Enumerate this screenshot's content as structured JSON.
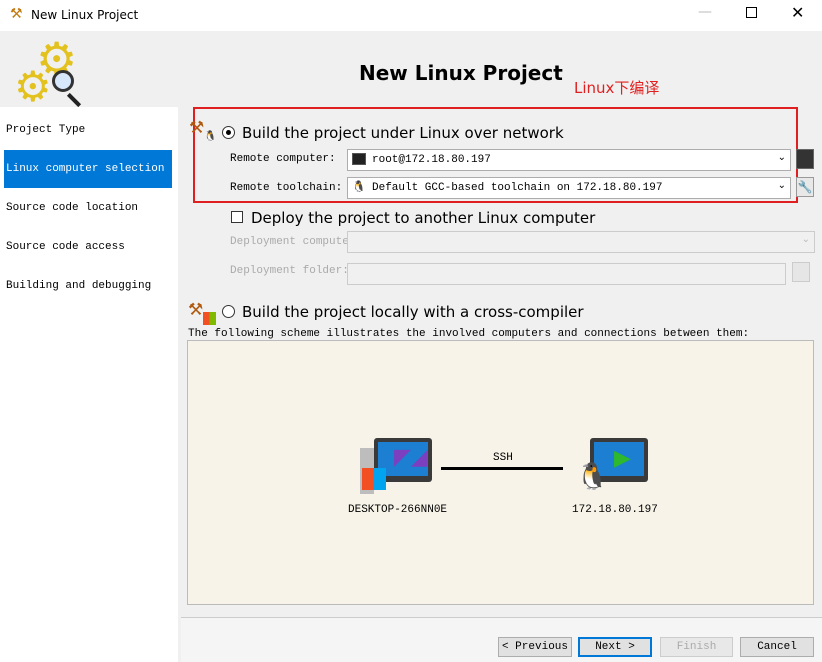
{
  "window": {
    "title": "New Linux Project",
    "heading": "New Linux Project",
    "annotation": "Linux下编译"
  },
  "sidebar": {
    "items": [
      {
        "label": "Project Type"
      },
      {
        "label": "Linux computer selection"
      },
      {
        "label": "Source code location"
      },
      {
        "label": "Source code access"
      },
      {
        "label": "Building and debugging"
      }
    ]
  },
  "options": {
    "network_build": "Build the project under Linux over network",
    "deploy": "Deploy the project to another Linux computer",
    "local_build": "Build the project locally with a cross-compiler"
  },
  "fields": {
    "remote_computer_label": "Remote computer:",
    "remote_computer_value": "root@172.18.80.197",
    "remote_toolchain_label": "Remote toolchain:",
    "remote_toolchain_value": "Default GCC-based toolchain on 172.18.80.197",
    "deployment_computer_label": "Deployment computer:",
    "deployment_folder_label": "Deployment folder:"
  },
  "scheme": {
    "caption": "The following scheme illustrates the involved computers and connections between them:",
    "left_name": "DESKTOP-266NN0E",
    "right_name": "172.18.80.197",
    "link": "SSH"
  },
  "buttons": {
    "previous": "< Previous",
    "next": "Next >",
    "finish": "Finish",
    "cancel": "Cancel"
  },
  "colors": {
    "accent": "#0078d7",
    "annotation": "#e02020"
  }
}
